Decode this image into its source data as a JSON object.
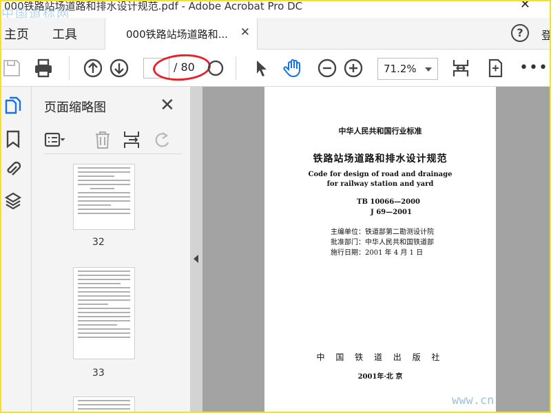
{
  "window": {
    "title": "000铁路站场道路和排水设计规范.pdf - Adobe Acrobat Pro DC",
    "close_glyph": "✕",
    "watermark_top": "中国道标网",
    "watermark_bottom": "www.cn"
  },
  "menu": {
    "home": "主页",
    "tools": "工具",
    "tab_label": "000铁路站场道路和...",
    "tab_close": "✕",
    "help": "?",
    "cut_text": "登"
  },
  "toolbar": {
    "page_total": "/ 80",
    "page_current": "",
    "zoom": "71.2%",
    "more": "•••",
    "highlight_color": "#e8202a",
    "accent_color": "#1473e6"
  },
  "panel": {
    "title": "页面缩略图",
    "close": "✕",
    "thumbnails": [
      {
        "page": "32"
      },
      {
        "page": "33"
      }
    ]
  },
  "document": {
    "header": "中华人民共和国行业标准",
    "title_cn": "铁路站场道路和排水设计规范",
    "title_en_1": "Code for design of road and drainage",
    "title_en_2": "for railway station and yard",
    "code_1": "TB 10066—2000",
    "code_2": "J 69—2001",
    "editor": "主编单位：铁道部第二勘测设计院",
    "approver": "批准部门：中华人民共和国铁道部",
    "effective": "施行日期：2001 年 4 月 1 日",
    "publisher": "中 国 铁 道 出 版 社",
    "pub_info": "2001年·北 京"
  }
}
